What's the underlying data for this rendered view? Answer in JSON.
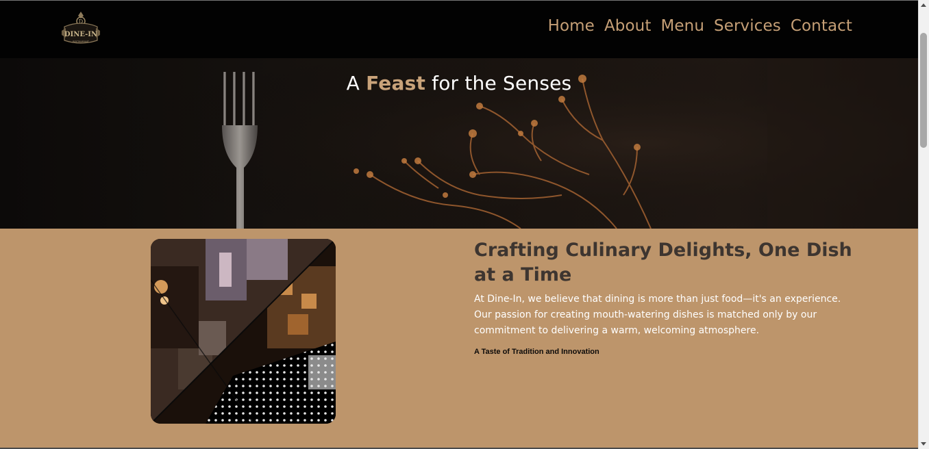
{
  "header": {
    "logo_icon": "dine-in-restaurant-logo-icon",
    "logo_text": "DINE-IN",
    "logo_subtext": "RESTAURANT",
    "nav": [
      {
        "label": "Home"
      },
      {
        "label": "About"
      },
      {
        "label": "Menu"
      },
      {
        "label": "Services"
      },
      {
        "label": "Contact"
      }
    ]
  },
  "hero": {
    "title_prefix": "A ",
    "title_accent": "Feast",
    "title_suffix": " for the Senses",
    "image": "fork-and-dried-flowers-image"
  },
  "about": {
    "heading": "Crafting Culinary Delights, One Dish at a Time",
    "text": "At Dine-In, we believe that dining is more than just food—it's an experience. Our passion for creating mouth-watering dishes is matched only by our commitment to delivering a warm, welcoming atmosphere.",
    "subheading": "A Taste of Tradition and Innovation",
    "image": "restaurant-interior-collage-image"
  },
  "colors": {
    "accent": "#c59f76",
    "section_bg": "#bd956b",
    "header_bg": "#020202",
    "heading_text": "#3d3530"
  }
}
